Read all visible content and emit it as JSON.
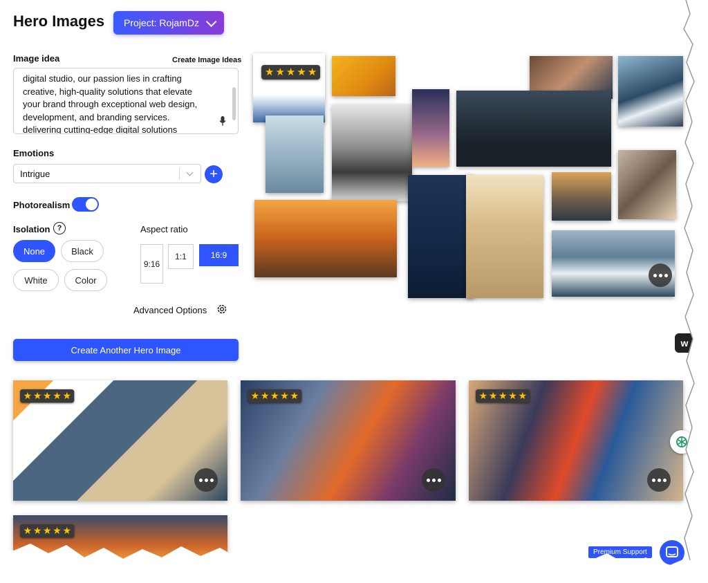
{
  "header": {
    "title": "Hero Images",
    "project_label": "Project: RojamDz"
  },
  "image_idea": {
    "label": "Image idea",
    "create_ideas_link": "Create Image Ideas",
    "lines": [
      "digital studio, our passion lies in crafting",
      "creative, high-quality solutions that elevate",
      "your brand through exceptional web design,",
      "development, and branding services.",
      "delivering cutting-edge digital solutions"
    ]
  },
  "emotions": {
    "label": "Emotions",
    "selected": "Intrigue"
  },
  "photorealism": {
    "label": "Photorealism",
    "enabled": true
  },
  "isolation": {
    "label": "Isolation",
    "help": "?",
    "options": [
      "None",
      "Black",
      "White",
      "Color"
    ],
    "selected": "None"
  },
  "aspect_ratio": {
    "label": "Aspect ratio",
    "options": [
      "9:16",
      "1:1",
      "16:9"
    ],
    "selected": "16:9"
  },
  "advanced": {
    "label": "Advanced Options"
  },
  "create_button": {
    "label": "Create Another Hero Image"
  },
  "rating": {
    "stars": 5
  },
  "support": {
    "label": "Premium Support"
  },
  "colors": {
    "accent": "#2f55ff",
    "star": "#ffc107",
    "gradient_start": "#3b5bff",
    "gradient_end": "#8a3bd6"
  },
  "icons": [
    "chevron-down-icon",
    "mic-icon",
    "plus-icon",
    "help-icon",
    "gear-icon",
    "star-icon",
    "more-options-icon",
    "chat-icon",
    "chatgpt-icon"
  ]
}
